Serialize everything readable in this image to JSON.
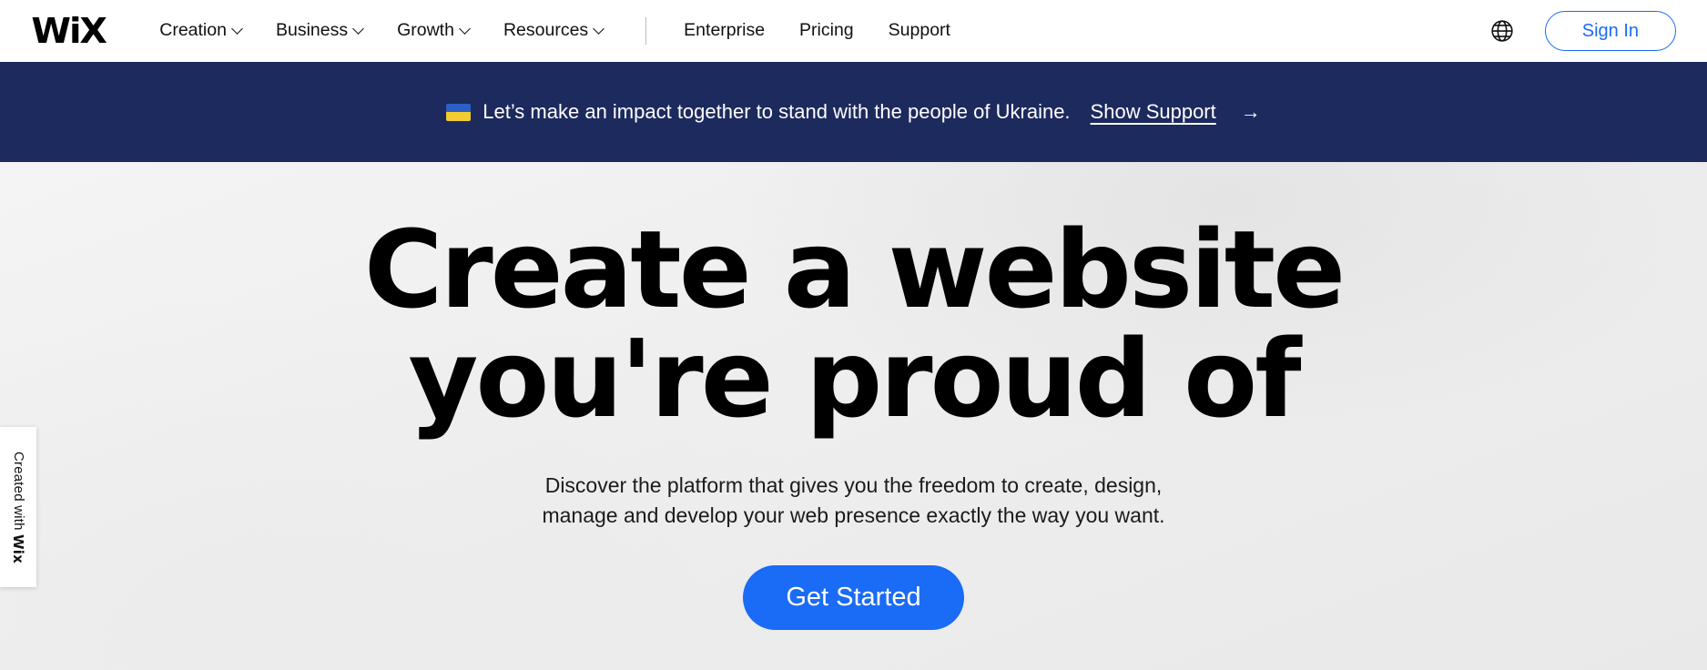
{
  "navbar": {
    "logo": "WiX",
    "menu": [
      {
        "label": "Creation",
        "has_caret": true
      },
      {
        "label": "Business",
        "has_caret": true
      },
      {
        "label": "Growth",
        "has_caret": true
      },
      {
        "label": "Resources",
        "has_caret": true
      }
    ],
    "links": [
      {
        "label": "Enterprise"
      },
      {
        "label": "Pricing"
      },
      {
        "label": "Support"
      }
    ],
    "language_icon": "globe-icon",
    "signin_label": "Sign In",
    "accent_color": "#1a6bf5"
  },
  "banner": {
    "flag_icon": "ukraine-flag-icon",
    "text": "Let’s make an impact together to stand with the people of Ukraine.",
    "link_label": "Show Support",
    "arrow": "→",
    "background_color": "#1d2a5e",
    "text_color": "#ffffff"
  },
  "hero": {
    "title_line1": "Create a website",
    "title_line2": "you're proud of",
    "subtitle_line1": "Discover the platform that gives you the freedom to create, design,",
    "subtitle_line2": "manage and develop your web presence exactly the way you want.",
    "cta_label": "Get Started",
    "cta_color": "#1a6bf5",
    "background_color": "#eeeeee"
  },
  "badge": {
    "prefix": "Created with ",
    "brand": "Wix"
  }
}
